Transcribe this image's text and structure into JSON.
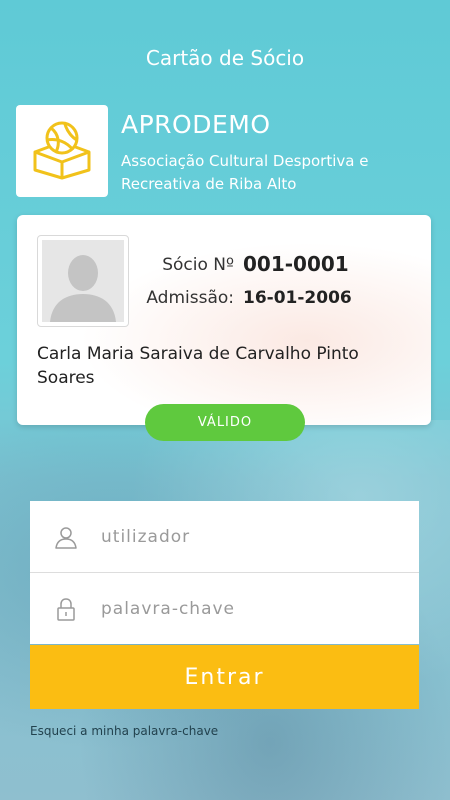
{
  "header": {
    "title": "Cartão de Sócio"
  },
  "organization": {
    "name": "APRODEMO",
    "description": "Associação Cultural Desportiva e Recreativa de Riba Alto"
  },
  "card": {
    "member_label": "Sócio Nº",
    "member_number": "001-0001",
    "admission_label": "Admissão:",
    "admission_date": "16-01-2006",
    "member_name": "Carla Maria Saraiva de Carvalho Pinto Soares",
    "status": "VÁLIDO"
  },
  "login": {
    "username_placeholder": "utilizador",
    "password_placeholder": "palavra-chave",
    "submit_label": "Entrar",
    "forgot_label": "Esqueci a minha palavra-chave"
  },
  "colors": {
    "accent": "#fbbd12",
    "status_ok": "#5fc93e",
    "background": "#6cd0da"
  },
  "icons": {
    "logo": "volleyball-logo-icon",
    "avatar": "person-silhouette-icon",
    "username": "user-icon",
    "password": "lock-icon"
  }
}
